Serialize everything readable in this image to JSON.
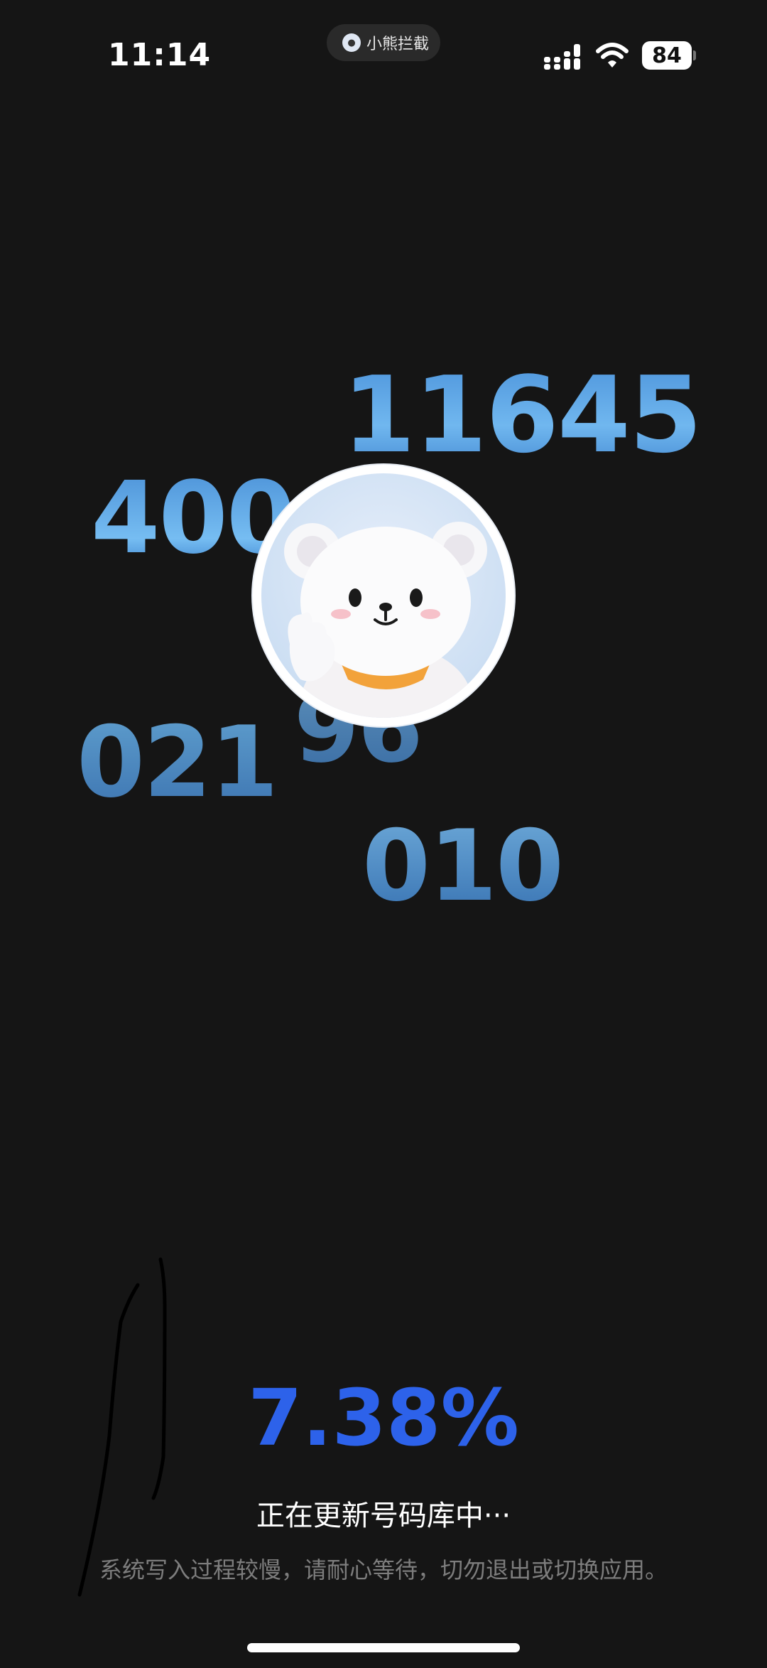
{
  "status_bar": {
    "time": "11:14",
    "app_pill_label": "小熊拦截",
    "battery_level": "84"
  },
  "floating_numbers": [
    "11645",
    "400",
    "021",
    "96",
    "010"
  ],
  "progress": {
    "percent_text": "7.38%",
    "value_percent": 7.38,
    "title": "正在更新号码库中···",
    "subtitle": "系统写入过程较慢，请耐心等待，切勿退出或切换应用。"
  },
  "colors": {
    "background": "#151515",
    "accent": "#2d62ea",
    "number_blue": "#5ea8e6"
  },
  "icons": [
    "signal-icon",
    "wifi-icon",
    "battery-icon",
    "bear-mascot"
  ]
}
